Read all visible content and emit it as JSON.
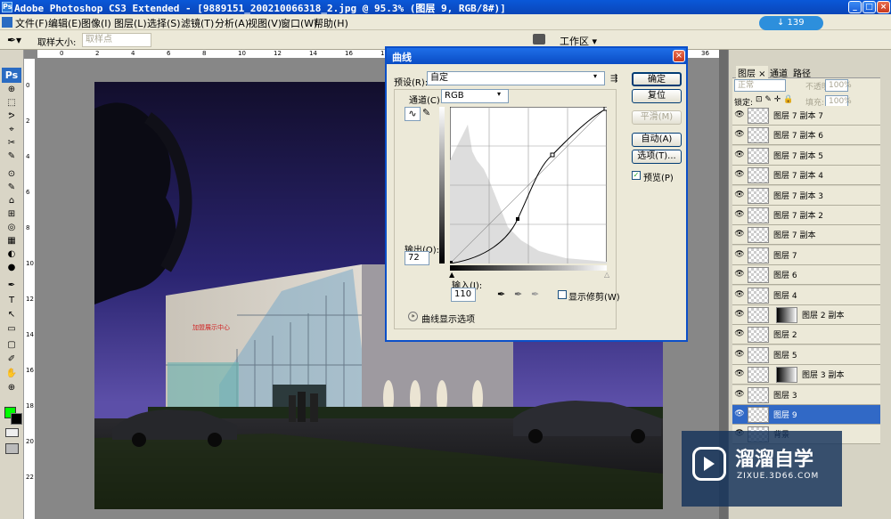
{
  "window": {
    "title": "Adobe Photoshop CS3 Extended - [9889151_200210066318_2.jpg @ 95.3% (图层 9, RGB/8#)]",
    "app_icon": "Ps",
    "minimize": "_",
    "restore": "□",
    "close": "×"
  },
  "menu": [
    "文件(F)",
    "编辑(E)",
    "图像(I)",
    "图层(L)",
    "选择(S)",
    "滤镜(T)",
    "分析(A)",
    "视图(V)",
    "窗口(W)",
    "帮助(H)"
  ],
  "netspeed": "↓ 139 KB/s",
  "options": {
    "sample_size_label": "取样大小:",
    "sample_size_value": "取样点",
    "workspace": "工作区 ▾"
  },
  "toolbox": {
    "logo": "Ps",
    "tools": [
      "⊕",
      "⬚",
      "ᕗ",
      "⌖",
      "✂",
      "✎",
      "⊙",
      "✎",
      "⌂",
      "⊞",
      "◎",
      "▦",
      "◐",
      "●",
      "✒",
      "T",
      "↖",
      "▭",
      "▢",
      "✐",
      "✋",
      "⊕"
    ]
  },
  "ruler": {
    "top_ticks": [
      "0",
      "2",
      "4",
      "6",
      "8",
      "10",
      "12",
      "14",
      "16",
      "18",
      "20",
      "22",
      "24",
      "26",
      "28",
      "30",
      "32",
      "34",
      "36"
    ],
    "left_ticks": [
      "0",
      "2",
      "4",
      "6",
      "8",
      "10",
      "12",
      "14",
      "16",
      "18",
      "20",
      "22"
    ]
  },
  "canvas": {
    "sign_text": "加盟展示中心"
  },
  "layers_panel": {
    "tabs": [
      "图层 ×",
      "通道",
      "路径"
    ],
    "blend_mode": "正常",
    "opacity_label": "不透明度:",
    "opacity_value": "100%",
    "lock_label": "锁定:",
    "fill_label": "填充:",
    "fill_value": "100%",
    "layers": [
      {
        "name": "图层 7 副本 7",
        "mask": false,
        "selected": false
      },
      {
        "name": "图层 7 副本 6",
        "mask": false,
        "selected": false
      },
      {
        "name": "图层 7 副本 5",
        "mask": false,
        "selected": false
      },
      {
        "name": "图层 7 副本 4",
        "mask": false,
        "selected": false
      },
      {
        "name": "图层 7 副本 3",
        "mask": false,
        "selected": false
      },
      {
        "name": "图层 7 副本 2",
        "mask": false,
        "selected": false
      },
      {
        "name": "图层 7 副本",
        "mask": false,
        "selected": false
      },
      {
        "name": "图层 7",
        "mask": false,
        "selected": false
      },
      {
        "name": "图层 6",
        "mask": false,
        "selected": false
      },
      {
        "name": "图层 4",
        "mask": false,
        "selected": false
      },
      {
        "name": "图层 2 副本",
        "mask": true,
        "selected": false
      },
      {
        "name": "图层 2",
        "mask": false,
        "selected": false
      },
      {
        "name": "图层 5",
        "mask": false,
        "selected": false
      },
      {
        "name": "图层 3 副本",
        "mask": true,
        "selected": false
      },
      {
        "name": "图层 3",
        "mask": false,
        "selected": false
      },
      {
        "name": "图层 9",
        "mask": false,
        "selected": true
      },
      {
        "name": "背景",
        "mask": false,
        "selected": false
      }
    ]
  },
  "curves_dialog": {
    "title": "曲线",
    "preset_label": "预设(R):",
    "preset_value": "自定",
    "channel_label": "通道(C):",
    "channel_value": "RGB",
    "output_label": "输出(O):",
    "output_value": "72",
    "input_label": "输入(I):",
    "input_value": "110",
    "show_clipping": "显示修剪(W)",
    "display_options": "曲线显示选项",
    "preview": "预览(P)",
    "buttons": {
      "ok": "确定",
      "reset": "复位",
      "smooth": "平滑(M)",
      "auto": "自动(A)",
      "options": "选项(T)..."
    }
  },
  "watermark": {
    "brand": "溜溜自学",
    "url": "ZIXUE.3D66.COM"
  }
}
